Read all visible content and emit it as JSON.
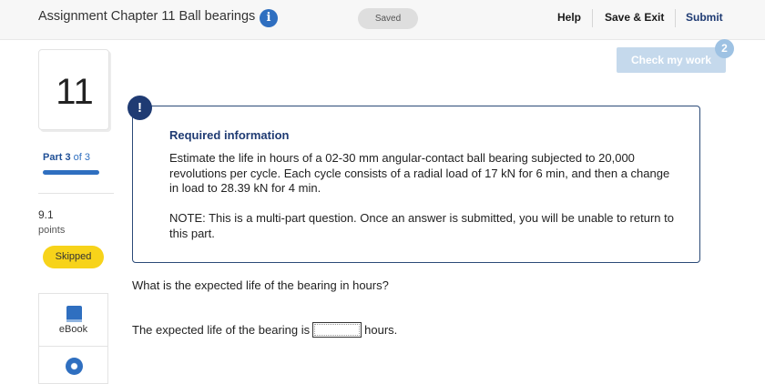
{
  "header": {
    "title": "Assignment Chapter 11 Ball bearings",
    "info_icon": "i",
    "saved_label": "Saved",
    "help_label": "Help",
    "save_exit_label": "Save & Exit",
    "submit_label": "Submit"
  },
  "check_work": {
    "label": "Check my work",
    "attempts_badge": "2"
  },
  "question_nav": {
    "number": "11",
    "part_prefix": "Part 3",
    "part_suffix": "of 3",
    "part_progress": 1.0,
    "points_value": "9.1",
    "points_label": "points",
    "status_badge": "Skipped",
    "tools": [
      {
        "label": "eBook",
        "icon": "book-icon"
      },
      {
        "label": "",
        "icon": "lifebuoy-icon"
      }
    ]
  },
  "required_info": {
    "alert_icon": "!",
    "heading": "Required information",
    "body": "Estimate the life in hours of a 02-30 mm angular-contact ball bearing subjected to 20,000 revolutions per cycle. Each cycle consists of a radial load of 17 kN for 6 min, and then a change in load to 28.39 kN for 4 min.",
    "note": "NOTE: This is a multi-part question. Once an answer is submitted, you will be unable to return to this part."
  },
  "question": {
    "prompt": "What is the expected life of the bearing in hours?",
    "answer_prefix": "The expected life of the bearing is",
    "answer_value": "",
    "answer_suffix": "hours."
  },
  "colors": {
    "accent": "#2f6fc0",
    "navy": "#1f3b73",
    "skipped_badge": "#f7d31a",
    "check_button_disabled": "#c5d9ec"
  }
}
